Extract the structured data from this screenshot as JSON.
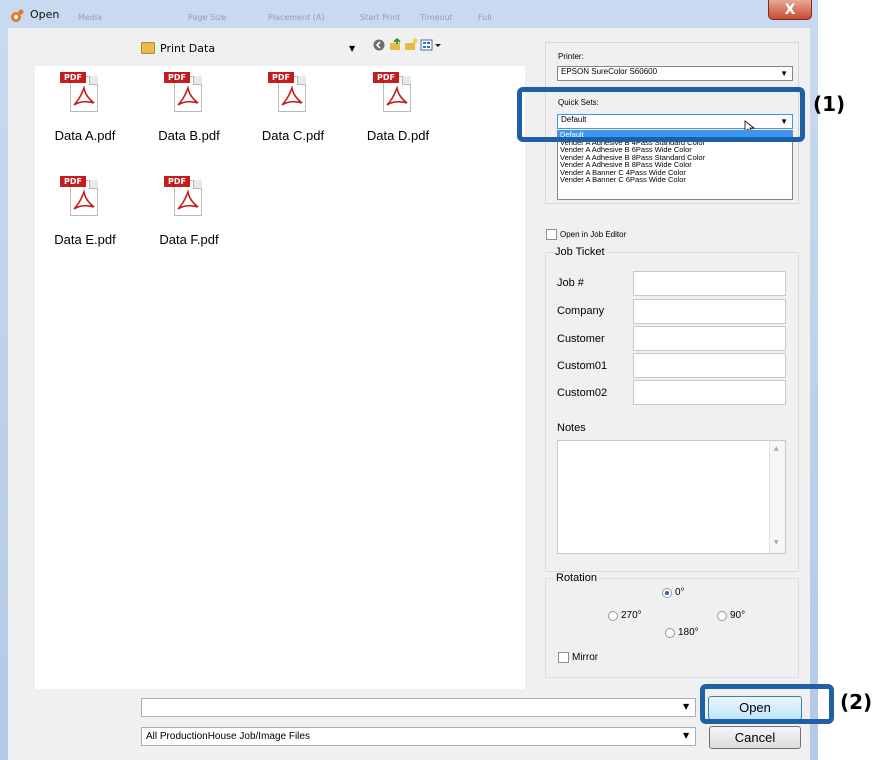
{
  "window": {
    "title": "Open",
    "close_glyph": "X",
    "ghost_tabs": [
      "Media",
      "Page Size",
      "Placement (A)",
      "Start Print",
      "Timeout",
      "Full"
    ]
  },
  "toolbar": {
    "folder": "Print Data",
    "icons": [
      "back-icon",
      "up-folder-icon",
      "new-folder-icon",
      "view-menu-icon"
    ]
  },
  "files": [
    {
      "name": "Data A.pdf",
      "badge": "PDF"
    },
    {
      "name": "Data B.pdf",
      "badge": "PDF"
    },
    {
      "name": "Data C.pdf",
      "badge": "PDF"
    },
    {
      "name": "Data D.pdf",
      "badge": "PDF"
    },
    {
      "name": "Data E.pdf",
      "badge": "PDF"
    },
    {
      "name": "Data F.pdf",
      "badge": "PDF"
    }
  ],
  "printer": {
    "label": "Printer:",
    "value": "EPSON SureColor S60600"
  },
  "quick_sets": {
    "label": "Quick Sets:",
    "value": "Default",
    "options": [
      "Default",
      "Vender A Adhesive B 4Pass Standard Color",
      "Vender A Adhesive B 6Pass Wide Color",
      "Vender A Adhesive B 8Pass Standard Color",
      "Vender A Adhesive B 8Pass Wide Color",
      "Vender A Banner C 4Pass Wide Color",
      "Vender A Banner C 6Pass Wide Color"
    ]
  },
  "job_editor": {
    "label": "Open in Job Editor",
    "checked": false
  },
  "job_ticket": {
    "title": "Job Ticket",
    "fields": [
      {
        "label": "Job #",
        "value": ""
      },
      {
        "label": "Company",
        "value": ""
      },
      {
        "label": "Customer",
        "value": ""
      },
      {
        "label": "Custom01",
        "value": ""
      },
      {
        "label": "Custom02",
        "value": ""
      }
    ],
    "notes_label": "Notes",
    "notes_value": ""
  },
  "rotation": {
    "title": "Rotation",
    "options": [
      "0°",
      "270°",
      "90°",
      "180°"
    ],
    "selected": "0°",
    "mirror_label": "Mirror",
    "mirror_checked": false
  },
  "bottom": {
    "filename_value": "",
    "filetype": "All ProductionHouse Job/Image Files",
    "open_label": "Open",
    "cancel_label": "Cancel"
  },
  "callouts": [
    "(1)",
    "(2)"
  ],
  "colors": {
    "callout": "#1f5fa3",
    "selection": "#3399ff",
    "pdf_red": "#c51d1d"
  }
}
